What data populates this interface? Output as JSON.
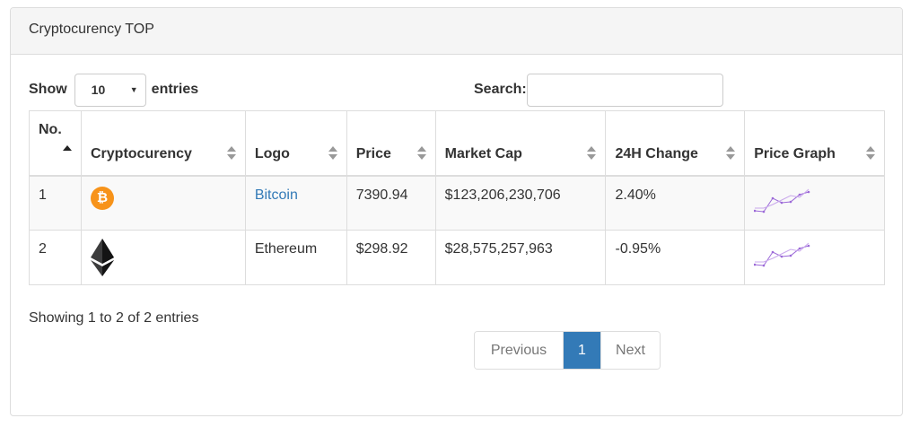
{
  "panel": {
    "title": "Cryptocurency TOP"
  },
  "length": {
    "prefix": "Show",
    "value": "10",
    "suffix": "entries"
  },
  "search": {
    "label": "Search:",
    "value": "",
    "placeholder": ""
  },
  "table": {
    "columns": [
      "No.",
      "Cryptocurency",
      "Logo",
      "Price",
      "Market Cap",
      "24H Change",
      "Price Graph"
    ],
    "rows": [
      {
        "no": "1",
        "icon": "bitcoin-icon",
        "logo": "Bitcoin",
        "price": "7390.94",
        "market_cap": "$123,206,230,706",
        "change": "2.40%"
      },
      {
        "no": "2",
        "icon": "ethereum-icon",
        "logo": "Ethereum",
        "price": "$298.92",
        "market_cap": "$28,575,257,963",
        "change": "-0.95%"
      }
    ]
  },
  "info": "Showing 1 to 2 of 2 entries",
  "pagination": {
    "previous": "Previous",
    "current": "1",
    "next": "Next"
  },
  "colors": {
    "accent": "#337ab7",
    "bitcoin": "#f7931a",
    "sparkline": "#9c6ad8"
  }
}
